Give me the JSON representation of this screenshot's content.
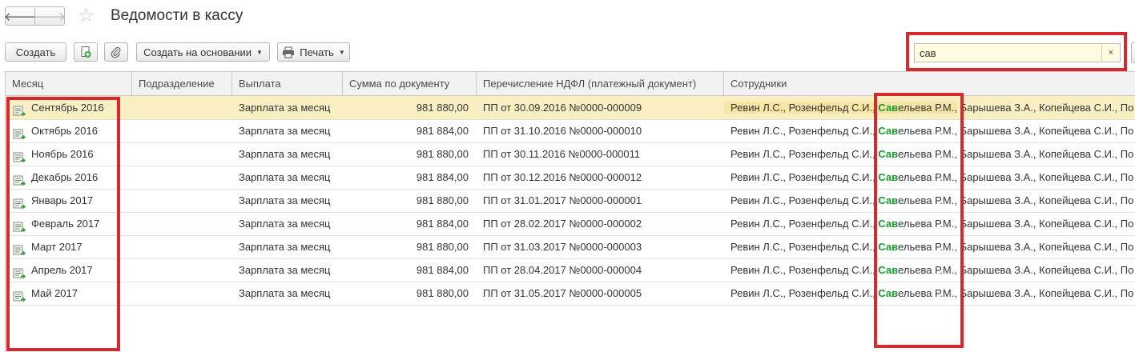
{
  "window": {
    "title": "Ведомости в кассу"
  },
  "nav": {
    "back_icon": "arrow-left-icon",
    "forward_icon": "arrow-right-icon",
    "favorite_icon": "star-icon"
  },
  "toolbar": {
    "create_label": "Создать",
    "copy_icon": "copy-add-icon",
    "attach_icon": "paperclip-icon",
    "create_based_label": "Создать на основании",
    "print_label": "Печать"
  },
  "search": {
    "value": "сав",
    "clear_label": "×"
  },
  "colors": {
    "highlight_border": "#d9272e",
    "selected_row": "#faefc3",
    "match_text": "#1a9b2c"
  },
  "table": {
    "columns": {
      "month": "Месяц",
      "division": "Подразделение",
      "payment": "Выплата",
      "amount": "Сумма по документу",
      "ndfl": "Перечисление НДФЛ (платежный документ)",
      "employees": "Сотрудники"
    },
    "employees_text": {
      "before": "Ревин Л.С., Розенфельд С.И., ",
      "match": "Сав",
      "match_rest": "ельева Р.М.,",
      "after": " Барышева З.А., Копейцева С.И., По"
    },
    "rows": [
      {
        "month": "Сентябрь 2016",
        "division": "",
        "payment": "Зарплата за месяц",
        "amount": "981 880,00",
        "ndfl": "ПП от 30.09.2016 №0000-000009"
      },
      {
        "month": "Октябрь 2016",
        "division": "",
        "payment": "Зарплата за месяц",
        "amount": "981 884,00",
        "ndfl": "ПП от 31.10.2016 №0000-000010"
      },
      {
        "month": "Ноябрь 2016",
        "division": "",
        "payment": "Зарплата за месяц",
        "amount": "981 880,00",
        "ndfl": "ПП от 30.11.2016 №0000-000011"
      },
      {
        "month": "Декабрь 2016",
        "division": "",
        "payment": "Зарплата за месяц",
        "amount": "981 884,00",
        "ndfl": "ПП от 30.12.2016 №0000-000012"
      },
      {
        "month": "Январь 2017",
        "division": "",
        "payment": "Зарплата за месяц",
        "amount": "981 880,00",
        "ndfl": "ПП от 31.01.2017 №0000-000001"
      },
      {
        "month": "Февраль 2017",
        "division": "",
        "payment": "Зарплата за месяц",
        "amount": "981 884,00",
        "ndfl": "ПП от 28.02.2017 №0000-000002"
      },
      {
        "month": "Март 2017",
        "division": "",
        "payment": "Зарплата за месяц",
        "amount": "981 880,00",
        "ndfl": "ПП от 31.03.2017 №0000-000003"
      },
      {
        "month": "Апрель 2017",
        "division": "",
        "payment": "Зарплата за месяц",
        "amount": "981 884,00",
        "ndfl": "ПП от 28.04.2017 №0000-000004"
      },
      {
        "month": "Май 2017",
        "division": "",
        "payment": "Зарплата за месяц",
        "amount": "981 880,00",
        "ndfl": "ПП от 31.05.2017 №0000-000005"
      }
    ]
  }
}
